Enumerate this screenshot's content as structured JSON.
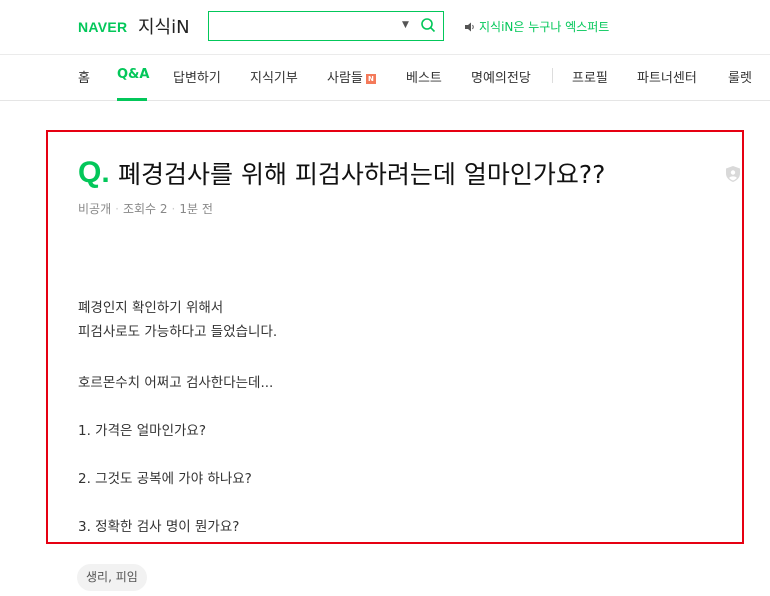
{
  "header": {
    "naver_logo": "NAVER",
    "service_name": "지식iN",
    "search": {
      "value": "",
      "placeholder": ""
    },
    "promo_text": "지식iN은 누구나 엑스퍼트"
  },
  "nav": {
    "items": [
      {
        "label": "홈",
        "active": false
      },
      {
        "label": "Q&A",
        "active": true
      },
      {
        "label": "답변하기",
        "active": false
      },
      {
        "label": "지식기부",
        "active": false
      },
      {
        "label": "사람들",
        "active": false,
        "badge": "N"
      },
      {
        "label": "베스트",
        "active": false
      },
      {
        "label": "명예의전당",
        "active": false
      },
      {
        "label": "프로필",
        "active": false
      },
      {
        "label": "파트너센터",
        "active": false
      },
      {
        "label": "룰렛",
        "active": false
      }
    ]
  },
  "question": {
    "q_mark": "Q.",
    "title": "폐경검사를 위해 피검사하려는데 얼마인가요??",
    "author": "비공개",
    "views": "조회수 2",
    "time": "1분 전",
    "body_lines": [
      "폐경인지 확인하기 위해서",
      "피검사로도 가능하다고 들었습니다.",
      "호르몬수치 어쩌고 검사한다는데...",
      "1. 가격은 얼마인가요?",
      "2. 그것도 공복에 가야 하나요?",
      "3. 정확한 검사 명이 뭔가요?"
    ],
    "tags": [
      "생리, 피임"
    ]
  },
  "colors": {
    "brand_green": "#03c75a",
    "highlight_border": "#e60012",
    "new_badge": "#f47a5a"
  }
}
